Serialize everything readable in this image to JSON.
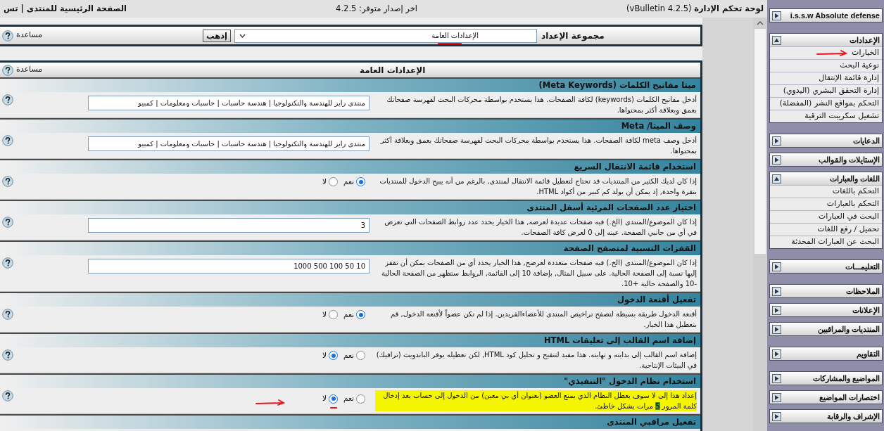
{
  "top_bar": {
    "title": "**لوحة تحكم الإدارة** (vBulletin 4.2.5)",
    "version_notice": "اخر إصدار متوفر: 4.2.5",
    "home_link": "الصفحة الرئيسية للمنتدى | تس"
  },
  "setting_group_bar": {
    "label": "مجموعة الإعداد",
    "select_value": "الإعدادات العامة",
    "select_annotated": true,
    "go_button": "إذهب",
    "help": "مساعدة"
  },
  "settings_panel": {
    "title": "الإعدادات العامة",
    "help": "مساعدة",
    "settings": [
      {
        "title": "ميتا مفاتيح الكلمات (Meta Keywords)",
        "description": [
          {
            "text": "أدخل مفاتيح الكلمات (keywords) لكافة الصفحات. هذا يستخدم بواسطة محركات البحث لفهرسة صفحاتك بعمق وبعلاقة أكثر بمحتواها.",
            "marked": false
          }
        ],
        "highlighted": false,
        "control": {
          "kind": "text",
          "value": "منتدى رايز للهندسة والتكنولوجيا | هندسة حاسبات | حاسبات ومعلومات | كمبيو"
        }
      },
      {
        "title": "وصف الميتا/ Meta",
        "description": [
          {
            "text": "أدخل وصف meta لكافة الصفحات. هذا يستخدم بواسطة محركات البحث لفهرسة صفحاتك بعمق وبعلاقة أكثر بمحتواها.",
            "marked": false
          }
        ],
        "highlighted": false,
        "control": {
          "kind": "text",
          "value": "منتدى رايز للهندسة والتكنولوجيا | هندسة حاسبات | حاسبات ومعلومات | كمبيو"
        }
      },
      {
        "title": "استخدام قائمة الانتقال السريع",
        "description": [
          {
            "text": "إذا كان لديك الكثير من المنتديات قد تحتاج لتعطيل قائمة الانتقال لمنتدى, بالرغم من أنه يبيح الدخول للمنتديات بنقرة واحدة, إذ يمكن أن يولد كم كبير من أكواد HTML.",
            "marked": false
          }
        ],
        "highlighted": false,
        "control": {
          "kind": "radio",
          "annotated": false,
          "options": [
            {
              "label": "نعم",
              "selected": true
            },
            {
              "label": "لا",
              "selected": false
            }
          ]
        }
      },
      {
        "title": "اختيار عدد الصفحات المرئية أسفل المنتدى",
        "description": [
          {
            "text": "إذا كان الموضوع/المنتدى (الخ.) فيه صفحات عديدة لعرضه, هذا الخيار يحدد عدد روابط الصفحات التي تعرض في أي من جانبي الصفحة. عينه إلى 0 لعرض كافة الصفحات.",
            "marked": false
          }
        ],
        "highlighted": false,
        "control": {
          "kind": "text",
          "value": "3"
        }
      },
      {
        "title": "القفزات النسبية لمتصفح الصفحة",
        "description": [
          {
            "text": "إذا كان الموضوع/المنتدى (الخ.) فيه صفحات متعددة لعرضح, هذا الخيار يحدد أي من الصفحات يمكن أن تقفز إليها نسبة إلى الصفحة الحالية. على سبيل المثال, بإضافة 10 إلى القائمة, الروابط ستظهر من الصفحة الحالية -10 والصفحة حالية +10.",
            "marked": false
          }
        ],
        "highlighted": false,
        "control": {
          "kind": "text",
          "value": "10 50 100 500 1000"
        }
      },
      {
        "title": "تفعيل أقنعة الدخول",
        "description": [
          {
            "text": "أقنعة الدخول طريقة بسيطة لتصفح تراخيص المنتدى للأعضاءالفريدين. إذا لم تكن عضواً لأقنعة الدخول, قم بتعطيل هذا الخيار.",
            "marked": false
          }
        ],
        "highlighted": false,
        "control": {
          "kind": "radio",
          "annotated": false,
          "options": [
            {
              "label": "نعم",
              "selected": true
            },
            {
              "label": "لا",
              "selected": false
            }
          ]
        }
      },
      {
        "title": "إضافة اسم القالب إلى تعليقات HTML",
        "description": [
          {
            "text": "إضافة اسم القالب إلى بدايته و نهايته. هذا مفيد لتنقيح و تحليل كود HTML, لكن تعطيله يوفر الباندويث (ترافيك) في البيئات الإنتاجية.",
            "marked": false
          }
        ],
        "highlighted": false,
        "control": {
          "kind": "radio",
          "annotated": false,
          "options": [
            {
              "label": "نعم",
              "selected": false
            },
            {
              "label": "لا",
              "selected": true
            }
          ]
        }
      },
      {
        "title": "استخدام نظام الدخول \"التنفيذي\"",
        "description": [
          {
            "text": "إعداد هذا إلى لا سوف يعطل النظام الذي يمنع العضو (بعنوان أي بي معين) من الدخول إلى حساب بعد إدخال كلمة المرور ",
            "marked": false
          },
          {
            "text": "5",
            "marked": true
          },
          {
            "text": " مرات بشكل خاطئ.",
            "marked": false
          }
        ],
        "highlighted": true,
        "control": {
          "kind": "radio",
          "annotated": true,
          "options": [
            {
              "label": "نعم",
              "selected": false
            },
            {
              "label": "لا",
              "selected": true
            }
          ]
        }
      },
      {
        "title": "تفعيل مراقبي المنتدى"
      }
    ]
  },
  "sidebar": {
    "blocks": [
      [
        {
          "title": "i.s.s.w Absolute defense",
          "expanded": false
        }
      ],
      [
        {
          "title": "الإعدادات",
          "expanded": true,
          "items": [
            {
              "label": "الخيارات",
              "annotated": true
            },
            {
              "label": "نوعية البحث",
              "annotated": false
            },
            {
              "label": "إدارة قائمة الإنتقال",
              "annotated": false
            },
            {
              "label": "إدارة التحقق البشري (اليدوي)",
              "annotated": false
            },
            {
              "label": "التحكم بمواقع النشر (المفضلة)",
              "annotated": false
            },
            {
              "label": "تشغيل سكريبت الترقية",
              "annotated": false
            }
          ]
        }
      ],
      [
        {
          "title": "الدعايات",
          "expanded": false
        },
        {
          "title": "الإستايلات والقوالب",
          "expanded": false
        },
        {
          "title": "اللغات والعبارات",
          "expanded": true,
          "items": [
            {
              "label": "التحكم باللغات",
              "annotated": false
            },
            {
              "label": "التحكم بالعبارات",
              "annotated": false
            },
            {
              "label": "البحث في العبارات",
              "annotated": false
            },
            {
              "label": "تحميل / رفع اللغات",
              "annotated": false
            },
            {
              "label": "البحث عن العبارات المحدثة",
              "annotated": false
            }
          ]
        }
      ],
      [
        {
          "title": "التعليمـــات",
          "expanded": false
        }
      ],
      [
        {
          "title": "الملاحظات",
          "expanded": false
        },
        {
          "title": "الإعلانات",
          "expanded": false
        },
        {
          "title": "المنتديات والمراقبين",
          "expanded": false
        }
      ],
      [
        {
          "title": "التقاويم",
          "expanded": false
        }
      ],
      [
        {
          "title": "المواضيع والمشاركات",
          "expanded": false
        },
        {
          "title": "اختصارات المواضيع",
          "expanded": false
        },
        {
          "title": "الإشراف والرقابة",
          "expanded": false
        }
      ]
    ]
  }
}
